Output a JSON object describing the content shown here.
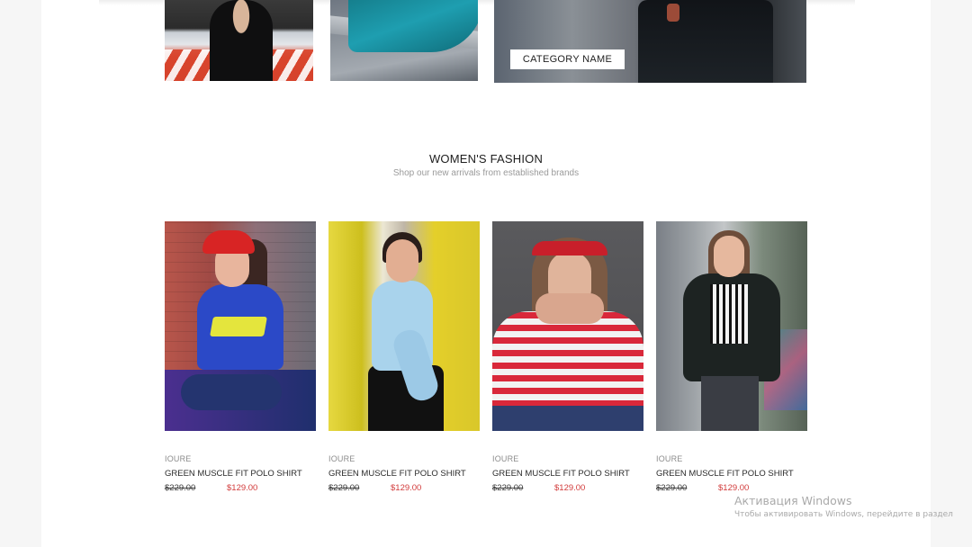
{
  "category_banner": {
    "label": "CATEGORY NAME"
  },
  "section": {
    "title": "WOMEN'S FASHION",
    "subtitle": "Shop our new arrivals from established brands"
  },
  "products": [
    {
      "brand": "IOURE",
      "name": "GREEN MUSCLE FIT POLO SHIRT",
      "old_price": "$229.00",
      "price": "$129.00"
    },
    {
      "brand": "IOURE",
      "name": "GREEN MUSCLE FIT POLO SHIRT",
      "old_price": "$229.00",
      "price": "$129.00"
    },
    {
      "brand": "IOURE",
      "name": "GREEN MUSCLE FIT POLO SHIRT",
      "old_price": "$229.00",
      "price": "$129.00"
    },
    {
      "brand": "IOURE",
      "name": "GREEN MUSCLE FIT POLO SHIRT",
      "old_price": "$229.00",
      "price": "$129.00"
    }
  ],
  "os_watermark": {
    "title": "Активация Windows",
    "subtitle": "Чтобы активировать Windows, перейдите в раздел"
  },
  "colors": {
    "sale_price": "#d23b3b",
    "text_dark": "#222222",
    "text_muted": "#9a9a9a"
  }
}
